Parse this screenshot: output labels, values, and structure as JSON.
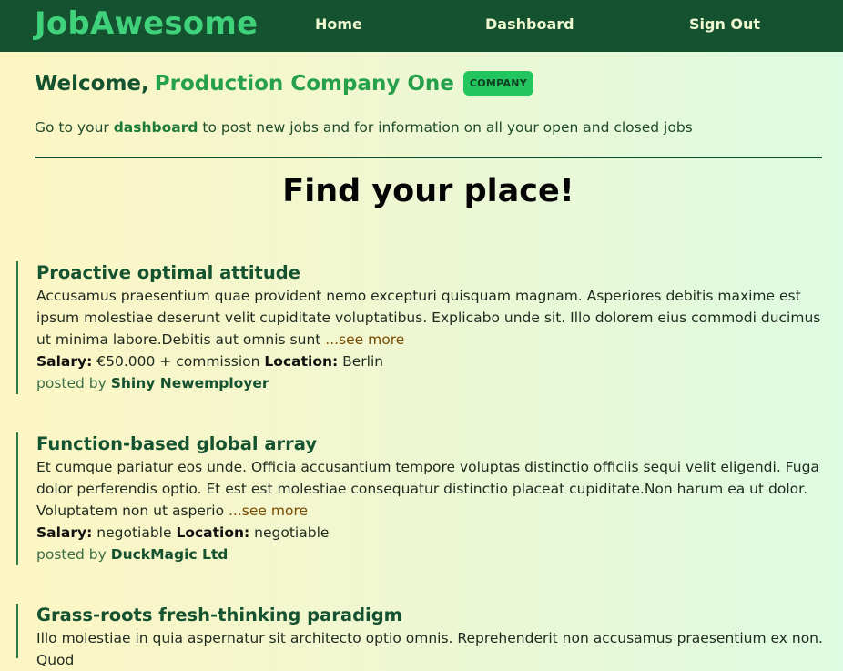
{
  "nav": {
    "brand": "JobAwesome",
    "home": "Home",
    "dashboard": "Dashboard",
    "sign_out": "Sign Out"
  },
  "welcome": {
    "prefix": "Welcome,",
    "company": "Production Company One",
    "badge": "COMPANY",
    "intro_before": "Go to your ",
    "intro_link": "dashboard",
    "intro_after": " to post new jobs and for information on all your open and closed jobs"
  },
  "hero": "Find your place!",
  "labels": {
    "salary": "Salary:",
    "location": "Location:",
    "posted_by": "posted by ",
    "see_more": "...see more"
  },
  "jobs": [
    {
      "title": "Proactive optimal attitude",
      "description": "Accusamus praesentium quae provident nemo excepturi quisquam magnam. Asperiores debitis maxime est ipsum molestiae deserunt velit cupiditate voluptatibus. Explicabo unde sit. Illo dolorem eius commodi ducimus ut minima labore.Debitis aut omnis sunt ",
      "salary": " €50.000 + commission ",
      "location": " Berlin",
      "employer": "Shiny Newemployer"
    },
    {
      "title": "Function-based global array",
      "description": "Et cumque pariatur eos unde. Officia accusantium tempore voluptas distinctio officiis sequi velit eligendi. Fuga dolor perferendis optio. Et est est molestiae consequatur distinctio placeat cupiditate.Non harum ea ut dolor. Voluptatem non ut asperio ",
      "salary": " negotiable ",
      "location": " negotiable",
      "employer": "DuckMagic Ltd"
    },
    {
      "title": "Grass-roots fresh-thinking paradigm",
      "description": "Illo molestiae in quia aspernatur sit architecto optio omnis. Reprehenderit non accusamus praesentium ex non. Quod"
    }
  ]
}
